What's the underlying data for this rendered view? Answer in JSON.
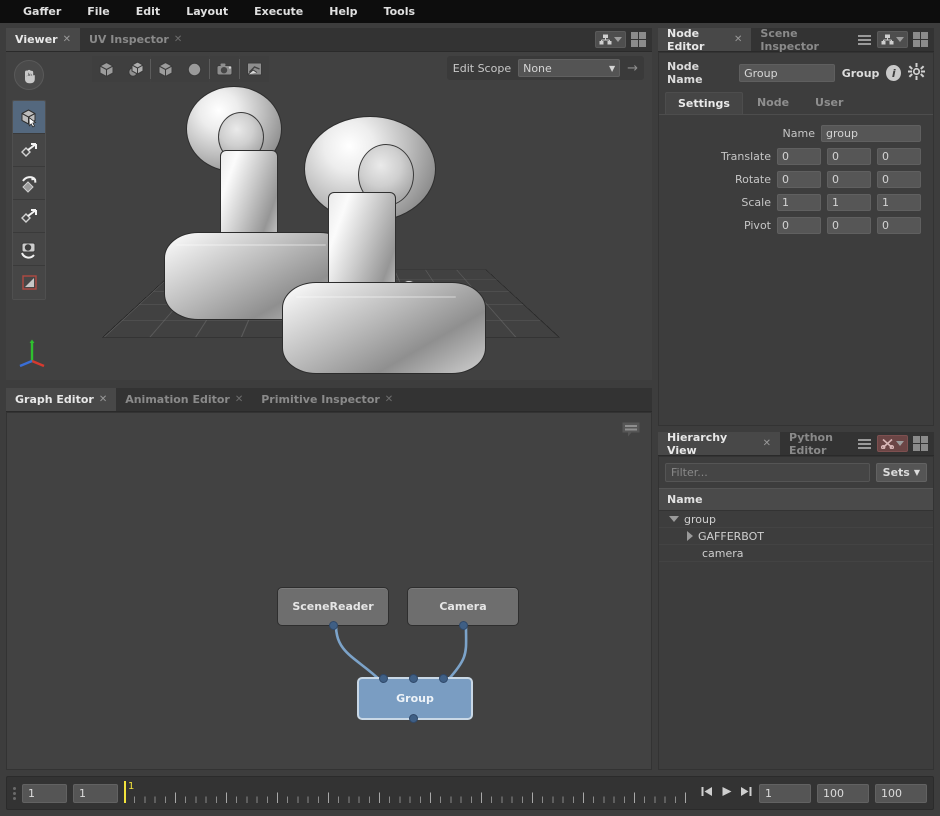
{
  "menubar": {
    "items": [
      {
        "label": "Gaffer"
      },
      {
        "label": "File"
      },
      {
        "label": "Edit"
      },
      {
        "label": "Layout"
      },
      {
        "label": "Execute"
      },
      {
        "label": "Help"
      },
      {
        "label": "Tools"
      }
    ]
  },
  "viewer": {
    "tabs": [
      {
        "label": "Viewer",
        "active": true,
        "close": "✕"
      },
      {
        "label": "UV Inspector",
        "active": false,
        "close": "✕"
      }
    ],
    "toolbar_icons": [
      "bounding-box-icon",
      "shaded-sphere-icon",
      "wireframe-cube-icon",
      "sphere-icon",
      "camera-icon",
      "layers-icon"
    ],
    "edit_scope": {
      "label": "Edit Scope",
      "value": "None",
      "caret": "▼",
      "arrow": "→"
    },
    "tools": [
      {
        "name": "pan-hand-tool",
        "selected": false
      },
      {
        "name": "select-tool",
        "selected": true
      },
      {
        "name": "translate-tool",
        "selected": false
      },
      {
        "name": "rotate-tool",
        "selected": false
      },
      {
        "name": "scale-tool",
        "selected": false
      },
      {
        "name": "camera-tool",
        "selected": false
      },
      {
        "name": "crop-window-tool",
        "selected": false
      }
    ],
    "axis_gizmo": {
      "x": "X",
      "y": "Y",
      "z": "Z"
    }
  },
  "graph_editor": {
    "tabs": [
      {
        "label": "Graph Editor",
        "active": true,
        "close": "✕"
      },
      {
        "label": "Animation Editor",
        "active": false,
        "close": "✕"
      },
      {
        "label": "Primitive Inspector",
        "active": false,
        "close": "✕"
      }
    ],
    "nodes": [
      {
        "label": "SceneReader",
        "selected": false
      },
      {
        "label": "Camera",
        "selected": false
      },
      {
        "label": "Group",
        "selected": true
      }
    ]
  },
  "node_editor": {
    "tabs": [
      {
        "label": "Node Editor",
        "active": true,
        "close": "✕"
      },
      {
        "label": "Scene Inspector",
        "active": false,
        "close": ""
      }
    ],
    "node_name_label": "Node Name",
    "node_name_value": "Group",
    "node_type": "Group",
    "info_glyph": "i",
    "subtabs": [
      {
        "label": "Settings",
        "active": true
      },
      {
        "label": "Node",
        "active": false
      },
      {
        "label": "User",
        "active": false
      }
    ],
    "params": [
      {
        "label": "Name",
        "values": [
          "group"
        ],
        "wide": true
      },
      {
        "label": "Translate",
        "values": [
          "0",
          "0",
          "0"
        ],
        "wide": false
      },
      {
        "label": "Rotate",
        "values": [
          "0",
          "0",
          "0"
        ],
        "wide": false
      },
      {
        "label": "Scale",
        "values": [
          "1",
          "1",
          "1"
        ],
        "wide": false
      },
      {
        "label": "Pivot",
        "values": [
          "0",
          "0",
          "0"
        ],
        "wide": false
      }
    ]
  },
  "hierarchy_view": {
    "tabs": [
      {
        "label": "Hierarchy View",
        "active": true,
        "close": "✕"
      },
      {
        "label": "Python Editor",
        "active": false,
        "close": ""
      }
    ],
    "filter_placeholder": "Filter...",
    "sets_label": "Sets",
    "sets_caret": "▼",
    "column_header": "Name",
    "rows": [
      {
        "label": "group",
        "indent": 0,
        "expander": "expanded"
      },
      {
        "label": "GAFFERBOT",
        "indent": 1,
        "expander": "collapsed"
      },
      {
        "label": "camera",
        "indent": 1,
        "expander": "none"
      }
    ]
  },
  "timeline": {
    "frame_start_field": "1",
    "frame_current_field": "1",
    "playhead_label": "1",
    "play_start": "1",
    "play_end": "100",
    "range_end": "100",
    "buttons": [
      "skip-to-start-icon",
      "play-icon",
      "skip-to-end-icon"
    ]
  },
  "colors": {
    "accent_selected_node": "#7a9dc2",
    "playhead": "#f2e33c",
    "panel_bg": "#3d3d3d",
    "menubar_bg": "#0d0d0d"
  }
}
